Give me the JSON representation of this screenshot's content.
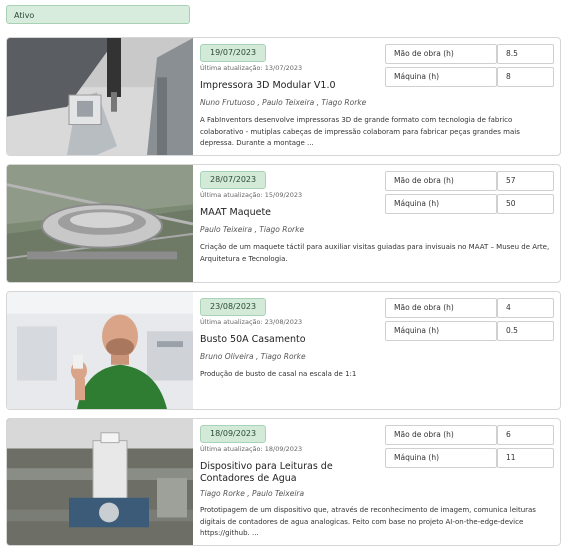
{
  "filter": {
    "status_label": "Ativo"
  },
  "hours_labels": {
    "labour": "Mão de obra (h)",
    "machine": "Máquina (h)"
  },
  "projects": [
    {
      "date": "19/07/2023",
      "updated": "Última atualização: 13/07/2023",
      "title": "Impressora 3D Modular V1.0",
      "authors": "Nuno Frutuoso , Paulo Teixeira , Tiago Rorke",
      "description": "A FabInventors desenvolve impressoras 3D de grande formato com tecnologia de fabrico colaborativo - mutiplas cabeças de impressão colaboram para fabricar peças grandes mais depressa. Durante a montage ...",
      "labour_hours": "8.5",
      "machine_hours": "8"
    },
    {
      "date": "28/07/2023",
      "updated": "Última atualização: 15/09/2023",
      "title": "MAAT Maquete",
      "authors": "Paulo Teixeira , Tiago Rorke",
      "description": "Criação de um maquete táctil para auxiliar visitas guiadas para invisuais no MAAT – Museu de Arte, Arquitetura e Tecnologia.",
      "labour_hours": "57",
      "machine_hours": "50"
    },
    {
      "date": "23/08/2023",
      "updated": "Última atualização: 23/08/2023",
      "title": "Busto 50A Casamento",
      "authors": "Bruno Oliveira , Tiago Rorke",
      "description": "Produção de busto de casal na escala de 1:1",
      "labour_hours": "4",
      "machine_hours": "0.5"
    },
    {
      "date": "18/09/2023",
      "updated": "Última atualização: 18/09/2023",
      "title": "Dispositivo para Leituras de Contadores de Agua",
      "authors": "Tiago Rorke , Paulo Teixeira",
      "description": "Prototipagem de um dispositivo que, através de reconhecimento de imagem, comunica leituras digitais de contadores de agua analogicas. Feito com base no projeto AI-on-the-edge-device https://github. ...",
      "labour_hours": "6",
      "machine_hours": "11"
    }
  ]
}
